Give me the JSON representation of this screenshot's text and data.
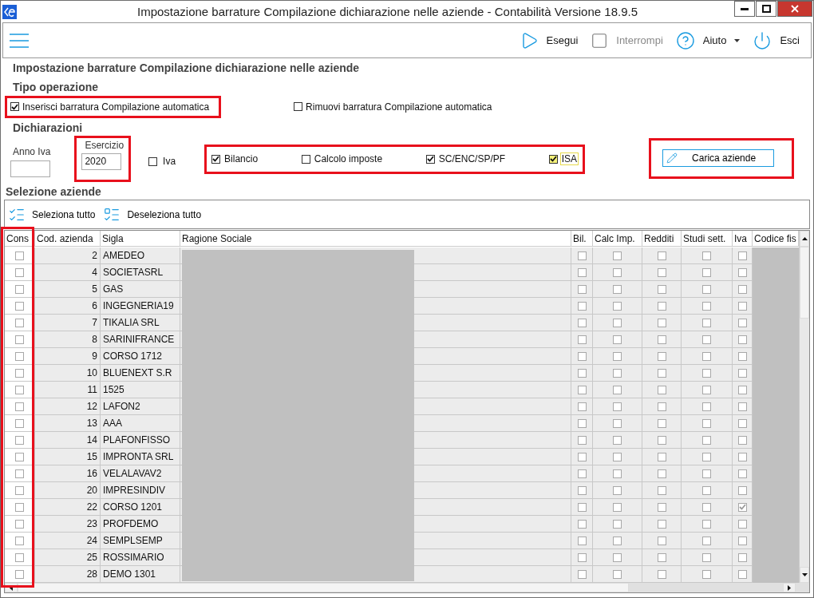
{
  "window": {
    "title": "Impostazione barrature Compilazione dichiarazione nelle aziende - Contabilità Versione 18.9.5"
  },
  "toolbar": {
    "buttons": [
      {
        "kind": "play",
        "label": "Esegui",
        "disabled": false
      },
      {
        "kind": "stop",
        "label": "Interrompi",
        "disabled": true
      },
      {
        "kind": "help",
        "label": "Aiuto",
        "disabled": false,
        "dropdown": true
      },
      {
        "kind": "power",
        "label": "Esci",
        "disabled": false
      }
    ]
  },
  "page_title": "Impostazione barrature Compilazione dichiarazione nelle aziende",
  "tipo_operazione": {
    "heading": "Tipo operazione",
    "options": [
      {
        "label": "Inserisci barratura Compilazione automatica",
        "checked": true,
        "highlighted": true
      },
      {
        "label": "Rimuovi barratura Compilazione automatica",
        "checked": false,
        "highlighted": false
      }
    ]
  },
  "dichiarazioni": {
    "heading": "Dichiarazioni",
    "anno_iva": {
      "label": "Anno Iva",
      "highlighted": false
    },
    "esercizio": {
      "label": "Esercizio",
      "value": "2020",
      "highlighted": true
    },
    "iva": {
      "label": "Iva",
      "checked": false
    },
    "group_highlighted": true,
    "types": [
      {
        "label": "Bilancio",
        "checked": true,
        "focused": false
      },
      {
        "label": "Calcolo imposte",
        "checked": false,
        "focused": false
      },
      {
        "label": "SC/ENC/SP/PF",
        "checked": true,
        "focused": false
      },
      {
        "label": "ISA",
        "checked": true,
        "focused": true
      }
    ],
    "load_button": {
      "label": "Carica aziende",
      "highlighted": true
    }
  },
  "selezione": {
    "heading": "Selezione aziende",
    "actions": [
      {
        "kind": "select",
        "label": "Seleziona tutto"
      },
      {
        "kind": "deselect",
        "label": "Deseleziona tutto"
      }
    ]
  },
  "table": {
    "columns": [
      "Cons",
      "Cod. azienda",
      "Sigla",
      "Ragione Sociale",
      "Bil.",
      "Calc Imp.",
      "Redditi",
      "Studi sett.",
      "Iva",
      "Codice fis"
    ],
    "cons_highlighted": true,
    "rows": [
      {
        "code": "2",
        "sigla": "AMEDEO",
        "cons": false,
        "bil": false,
        "calc_imp": false,
        "redditi": false,
        "studi": false,
        "iva": false
      },
      {
        "code": "4",
        "sigla": "SOCIETASRL",
        "cons": false,
        "bil": false,
        "calc_imp": false,
        "redditi": false,
        "studi": false,
        "iva": false
      },
      {
        "code": "5",
        "sigla": "GAS",
        "cons": false,
        "bil": false,
        "calc_imp": false,
        "redditi": false,
        "studi": false,
        "iva": false
      },
      {
        "code": "6",
        "sigla": "INGEGNERIA19",
        "cons": false,
        "bil": false,
        "calc_imp": false,
        "redditi": false,
        "studi": false,
        "iva": false
      },
      {
        "code": "7",
        "sigla": "TIKALIA SRL",
        "cons": false,
        "bil": false,
        "calc_imp": false,
        "redditi": false,
        "studi": false,
        "iva": false
      },
      {
        "code": "8",
        "sigla": "SARINIFRANCE",
        "cons": false,
        "bil": false,
        "calc_imp": false,
        "redditi": false,
        "studi": false,
        "iva": false
      },
      {
        "code": "9",
        "sigla": "CORSO 1712",
        "cons": false,
        "bil": false,
        "calc_imp": false,
        "redditi": false,
        "studi": false,
        "iva": false
      },
      {
        "code": "10",
        "sigla": "BLUENEXT S.R",
        "cons": false,
        "bil": false,
        "calc_imp": false,
        "redditi": false,
        "studi": false,
        "iva": false
      },
      {
        "code": "11",
        "sigla": "1525",
        "cons": false,
        "bil": false,
        "calc_imp": false,
        "redditi": false,
        "studi": false,
        "iva": false
      },
      {
        "code": "12",
        "sigla": "LAFON2",
        "cons": false,
        "bil": false,
        "calc_imp": false,
        "redditi": false,
        "studi": false,
        "iva": false
      },
      {
        "code": "13",
        "sigla": "AAA",
        "cons": false,
        "bil": false,
        "calc_imp": false,
        "redditi": false,
        "studi": false,
        "iva": false
      },
      {
        "code": "14",
        "sigla": "PLAFONFISSO",
        "cons": false,
        "bil": false,
        "calc_imp": false,
        "redditi": false,
        "studi": false,
        "iva": false
      },
      {
        "code": "15",
        "sigla": "IMPRONTA SRL",
        "cons": false,
        "bil": false,
        "calc_imp": false,
        "redditi": false,
        "studi": false,
        "iva": false
      },
      {
        "code": "16",
        "sigla": "VELALAVAV2",
        "cons": false,
        "bil": false,
        "calc_imp": false,
        "redditi": false,
        "studi": false,
        "iva": false
      },
      {
        "code": "20",
        "sigla": "IMPRESINDIV",
        "cons": false,
        "bil": false,
        "calc_imp": false,
        "redditi": false,
        "studi": false,
        "iva": false
      },
      {
        "code": "22",
        "sigla": "CORSO 1201",
        "cons": false,
        "bil": false,
        "calc_imp": false,
        "redditi": false,
        "studi": false,
        "iva": true
      },
      {
        "code": "23",
        "sigla": "PROFDEMO",
        "cons": false,
        "bil": false,
        "calc_imp": false,
        "redditi": false,
        "studi": false,
        "iva": false
      },
      {
        "code": "24",
        "sigla": "SEMPLSEMP",
        "cons": false,
        "bil": false,
        "calc_imp": false,
        "redditi": false,
        "studi": false,
        "iva": false
      },
      {
        "code": "25",
        "sigla": "ROSSIMARIO",
        "cons": false,
        "bil": false,
        "calc_imp": false,
        "redditi": false,
        "studi": false,
        "iva": false
      },
      {
        "code": "28",
        "sigla": "DEMO 1301",
        "cons": false,
        "bil": false,
        "calc_imp": false,
        "redditi": false,
        "studi": false,
        "iva": false
      }
    ]
  }
}
